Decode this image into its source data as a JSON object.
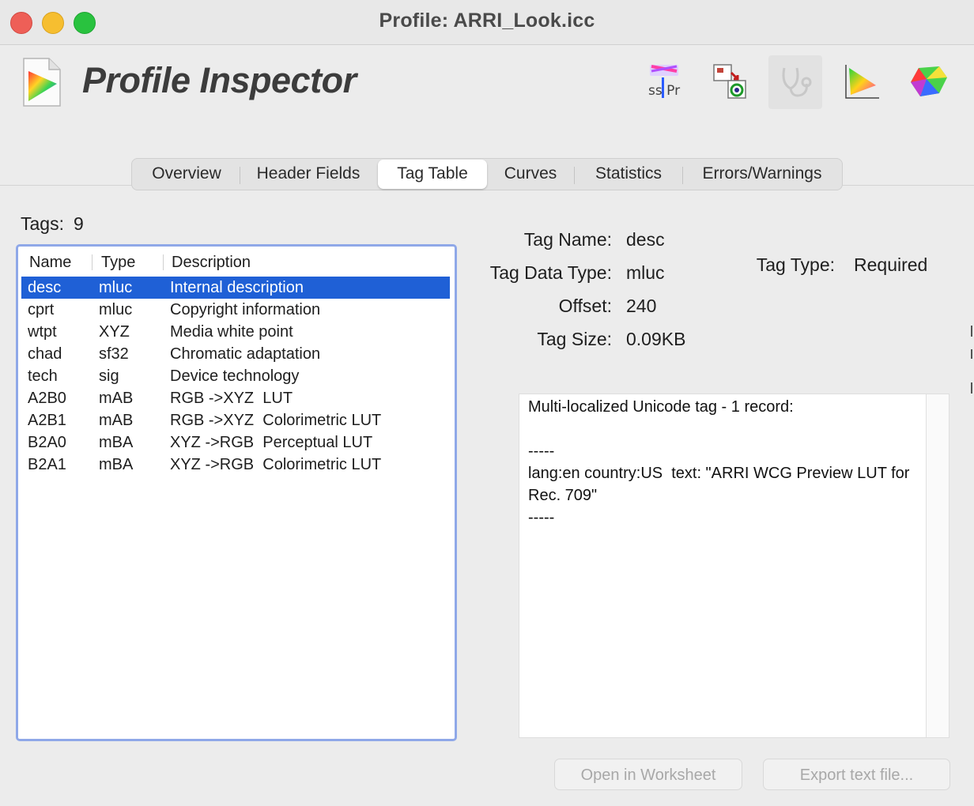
{
  "window": {
    "title": "Profile: ARRI_Look.icc"
  },
  "app": {
    "name": "Profile Inspector"
  },
  "toolbar": {
    "tools": [
      {
        "icon": "text-inspector-icon",
        "label": "ss Pr"
      },
      {
        "icon": "profile-convert-icon"
      },
      {
        "icon": "stethoscope-icon"
      },
      {
        "icon": "gamut-2d-plot-icon"
      },
      {
        "icon": "gamut-3d-plot-icon"
      }
    ]
  },
  "tabs": [
    {
      "label": "Overview"
    },
    {
      "label": "Header Fields"
    },
    {
      "label": "Tag Table",
      "selected": true
    },
    {
      "label": "Curves"
    },
    {
      "label": "Statistics"
    },
    {
      "label": "Errors/Warnings"
    }
  ],
  "tags": {
    "count_label": "Tags:",
    "count": "9",
    "columns": [
      "Name",
      "Type",
      "Description"
    ],
    "rows": [
      {
        "name": "desc",
        "type": "mluc",
        "description": "Internal description",
        "selected": true
      },
      {
        "name": "cprt",
        "type": "mluc",
        "description": "Copyright information"
      },
      {
        "name": "wtpt",
        "type": "XYZ",
        "description": "Media white point"
      },
      {
        "name": "chad",
        "type": "sf32",
        "description": "Chromatic adaptation"
      },
      {
        "name": "tech",
        "type": "sig",
        "description": "Device technology"
      },
      {
        "name": "A2B0",
        "type": "mAB",
        "description": "RGB ->XYZ  LUT"
      },
      {
        "name": "A2B1",
        "type": "mAB",
        "description": "RGB ->XYZ  Colorimetric LUT"
      },
      {
        "name": "B2A0",
        "type": "mBA",
        "description": "XYZ ->RGB  Perceptual LUT"
      },
      {
        "name": "B2A1",
        "type": "mBA",
        "description": "XYZ ->RGB  Colorimetric LUT"
      }
    ]
  },
  "details": {
    "tag_name_label": "Tag Name:",
    "tag_name": "desc",
    "data_type_label": "Tag Data Type:",
    "data_type": "mluc",
    "offset_label": "Offset:",
    "offset": "240",
    "size_label": "Tag Size:",
    "size": "0.09KB",
    "tag_type_label": "Tag Type:",
    "tag_type": "Required"
  },
  "text_panel": {
    "content": "Multi-localized Unicode tag - 1 record:\n\n-----\nlang:en country:US  text: \"ARRI WCG Preview LUT for Rec. 709\"\n-----"
  },
  "buttons": {
    "open_worksheet": "Open in Worksheet",
    "export_text": "Export text file..."
  },
  "colors": {
    "selection": "#1f60d6",
    "focus_ring": "#8fa8e8",
    "close": "#ee5f57",
    "minimize": "#f6be30",
    "maximize": "#29c23f"
  }
}
